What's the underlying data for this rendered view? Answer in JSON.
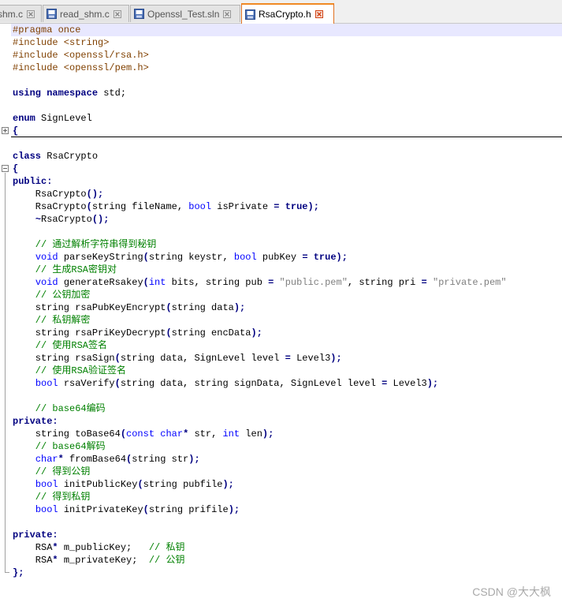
{
  "tabs": [
    {
      "label": "shm.c",
      "icon": "c-file-icon",
      "active": false
    },
    {
      "label": "read_shm.c",
      "icon": "c-file-icon",
      "active": false
    },
    {
      "label": "Openssl_Test.sln",
      "icon": "sln-file-icon",
      "active": false
    },
    {
      "label": "RsaCrypto.h",
      "icon": "header-file-icon",
      "active": true
    }
  ],
  "code": {
    "l1": [
      "#pragma once"
    ],
    "l2": [
      "#include <string>"
    ],
    "l3": [
      "#include <openssl/rsa.h>"
    ],
    "l4": [
      "#include <openssl/pem.h>"
    ],
    "l6": [
      "using",
      " ",
      "namespace",
      " std;"
    ],
    "l8": [
      "enum",
      " SignLevel"
    ],
    "l9": [
      "{"
    ],
    "l11": [
      "class",
      " RsaCrypto"
    ],
    "l12": [
      "{"
    ],
    "l13": [
      "public",
      ":"
    ],
    "l14": [
      "    RsaCrypto",
      "();"
    ],
    "l15": [
      "    RsaCrypto",
      "(",
      "string fileName, ",
      "bool",
      " isPrivate ",
      "=",
      " ",
      "true",
      ");"
    ],
    "l16": [
      "    ",
      "~",
      "RsaCrypto",
      "();"
    ],
    "l18": [
      "    // 通过解析字符串得到秘钥"
    ],
    "l19": [
      "    ",
      "void",
      " parseKeyString",
      "(",
      "string keystr, ",
      "bool",
      " pubKey ",
      "=",
      " ",
      "true",
      ");"
    ],
    "l20": [
      "    // 生成RSA密钥对"
    ],
    "l21": [
      "    ",
      "void",
      " generateRsakey",
      "(",
      "int",
      " bits, string pub ",
      "=",
      " ",
      "\"public.pem\"",
      ", string pri ",
      "=",
      " ",
      "\"private.pem\""
    ],
    "l22": [
      "    // 公钥加密"
    ],
    "l23": [
      "    string rsaPubKeyEncrypt",
      "(",
      "string data",
      ");"
    ],
    "l24": [
      "    // 私钥解密"
    ],
    "l25": [
      "    string rsaPriKeyDecrypt",
      "(",
      "string encData",
      ");"
    ],
    "l26": [
      "    // 使用RSA签名"
    ],
    "l27": [
      "    string rsaSign",
      "(",
      "string data, SignLevel level ",
      "=",
      " Level3",
      ");"
    ],
    "l28": [
      "    // 使用RSA验证签名"
    ],
    "l29": [
      "    ",
      "bool",
      " rsaVerify",
      "(",
      "string data, string signData, SignLevel level ",
      "=",
      " Level3",
      ");"
    ],
    "l31": [
      "    // base64编码"
    ],
    "l32": [
      "private",
      ":"
    ],
    "l33": [
      "    string toBase64",
      "(",
      "const",
      " ",
      "char",
      "*",
      " str, ",
      "int",
      " len",
      ");"
    ],
    "l34": [
      "    // base64解码"
    ],
    "l35": [
      "    ",
      "char",
      "*",
      " fromBase64",
      "(",
      "string str",
      ");"
    ],
    "l36": [
      "    // 得到公钥"
    ],
    "l37": [
      "    ",
      "bool",
      " initPublicKey",
      "(",
      "string pubfile",
      ");"
    ],
    "l38": [
      "    // 得到私钥"
    ],
    "l39": [
      "    ",
      "bool",
      " initPrivateKey",
      "(",
      "string prifile",
      ");"
    ],
    "l41": [
      "private",
      ":"
    ],
    "l42": [
      "    RSA",
      "*",
      " m_publicKey;   ",
      "// 私钥"
    ],
    "l43": [
      "    RSA",
      "*",
      " m_privateKey;  ",
      "// 公钥"
    ],
    "l44": [
      "};"
    ]
  },
  "watermark": "CSDN @大大枫"
}
